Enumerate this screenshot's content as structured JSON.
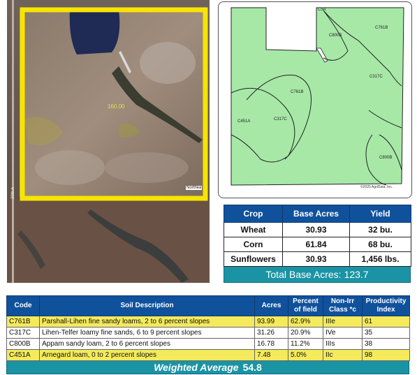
{
  "aerial": {
    "field_acres": "160.00",
    "corner_label": "Northea",
    "road_label": "20th A"
  },
  "soil_map": {
    "labels": [
      "C5A",
      "C800B",
      "C761B",
      "C317C",
      "C761B",
      "C451A",
      "C317C",
      "C800B"
    ],
    "copyright": "©2025 AgriData, Inc."
  },
  "crop_table": {
    "headers": [
      "Crop",
      "Base Acres",
      "Yield"
    ],
    "rows": [
      [
        "Wheat",
        "30.93",
        "32 bu."
      ],
      [
        "Corn",
        "61.84",
        "68 bu."
      ],
      [
        "Sunflowers",
        "30.93",
        "1,456 lbs."
      ]
    ],
    "total_label": "Total Base Acres:",
    "total_value": "123.7"
  },
  "soil_table": {
    "headers": {
      "code": "Code",
      "desc": "Soil Description",
      "acres": "Acres",
      "percent_l1": "Percent",
      "percent_l2": "of field",
      "class_l1": "Non-Irr",
      "class_l2": "Class *c",
      "prod_l1": "Productivity",
      "prod_l2": "Index"
    },
    "rows": [
      [
        "C761B",
        "Parshall-Lihen fine sandy loams, 2 to 6 percent slopes",
        "93.99",
        "62.9%",
        "IIIe",
        "61"
      ],
      [
        "C317C",
        "Lihen-Telfer loamy fine sands, 6 to 9 percent slopes",
        "31.26",
        "20.9%",
        "IVe",
        "35"
      ],
      [
        "C800B",
        "Appam sandy loam, 2 to 6 percent slopes",
        "16.78",
        "11.2%",
        "IIIs",
        "38"
      ],
      [
        "C451A",
        "Arnegard loam, 0 to 2 percent slopes",
        "7.48",
        "5.0%",
        "IIc",
        "98"
      ]
    ],
    "weighted_label": "Weighted Average",
    "weighted_value": "54.8"
  },
  "colors": {
    "header_blue": "#10519c",
    "teal": "#1a94a4",
    "highlight_yellow": "#f4ea5c",
    "boundary_yellow": "#f7e400",
    "soil_green": "#a7e8a7"
  }
}
